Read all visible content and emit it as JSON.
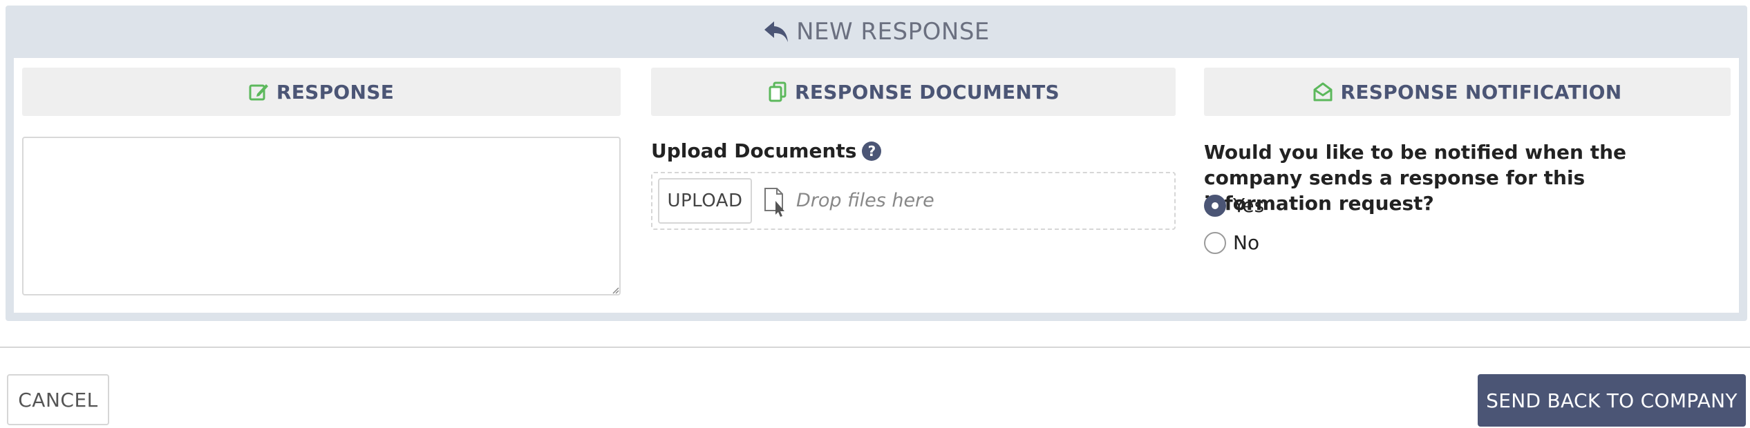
{
  "header": {
    "title": "NEW RESPONSE",
    "icon": "reply-icon"
  },
  "sections": {
    "response": {
      "title": "RESPONSE",
      "icon": "edit-icon"
    },
    "documents": {
      "title": "RESPONSE DOCUMENTS",
      "icon": "copy-icon"
    },
    "notification": {
      "title": "RESPONSE NOTIFICATION",
      "icon": "envelope-open-icon"
    }
  },
  "response_field": {
    "value": "",
    "placeholder": ""
  },
  "upload": {
    "label": "Upload Documents",
    "help_glyph": "?",
    "button_label": "UPLOAD",
    "drop_text": "Drop files here"
  },
  "notification": {
    "question": "Would you like to be notified when the company sends a response for this information request?",
    "options": [
      {
        "label": "Yes",
        "selected": true
      },
      {
        "label": "No",
        "selected": false
      }
    ]
  },
  "footer": {
    "cancel_label": "CANCEL",
    "send_label": "SEND BACK TO COMPANY"
  },
  "colors": {
    "accent": "#4b5575",
    "icon_green": "#5cb85c",
    "panel_bg": "#dde3ea"
  }
}
